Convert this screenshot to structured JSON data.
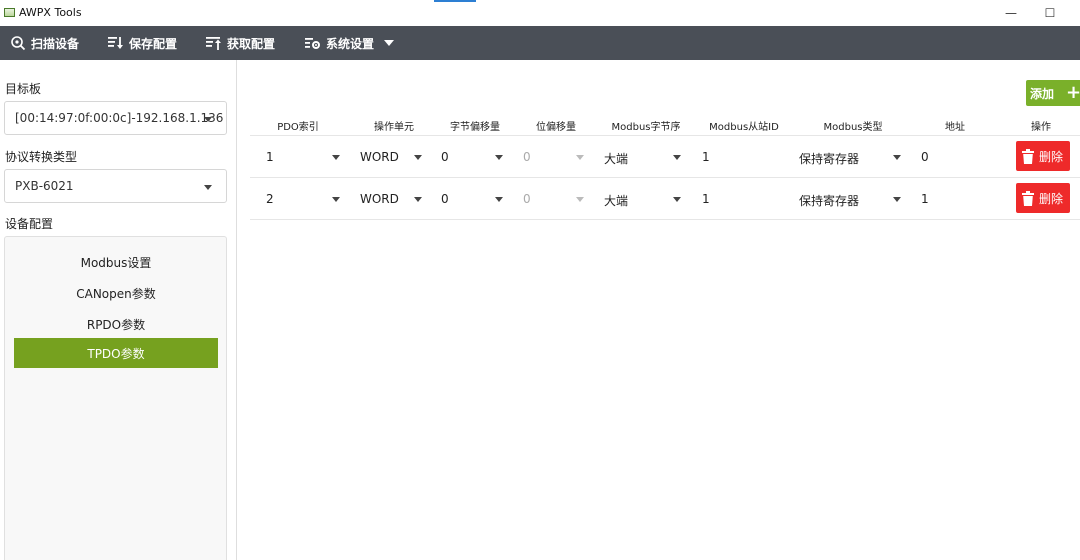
{
  "window": {
    "title": "AWPX Tools",
    "minimize": "—",
    "maximize": "☐"
  },
  "toolbar": {
    "scan_label": "扫描设备",
    "save_label": "保存配置",
    "fetch_label": "获取配置",
    "settings_label": "系统设置"
  },
  "sidebar": {
    "target_label": "目标板",
    "target_value": "[00:14:97:0f:00:0c]-192.168.1.136",
    "protocol_label": "协议转换类型",
    "protocol_value": "PXB-6021",
    "device_label": "设备配置",
    "menu": [
      {
        "label": "Modbus设置"
      },
      {
        "label": "CANopen参数"
      },
      {
        "label": "RPDO参数"
      },
      {
        "label": "TPDO参数"
      }
    ]
  },
  "main": {
    "add_label": "添加",
    "columns": [
      "PDO索引",
      "操作单元",
      "字节偏移量",
      "位偏移量",
      "Modbus字节序",
      "Modbus从站ID",
      "Modbus类型",
      "地址",
      "操作"
    ],
    "rows": [
      {
        "index": "1",
        "unit": "WORD",
        "byte_offset": "0",
        "bit_offset": "0",
        "byte_order": "大端",
        "slave_id": "1",
        "type": "保持寄存器",
        "address": "0",
        "delete_label": "删除"
      },
      {
        "index": "2",
        "unit": "WORD",
        "byte_offset": "0",
        "bit_offset": "0",
        "byte_order": "大端",
        "slave_id": "1",
        "type": "保持寄存器",
        "address": "1",
        "delete_label": "删除"
      }
    ]
  },
  "colors": {
    "toolbar_bg": "#4a4f57",
    "accent_green": "#76a11f",
    "add_green": "#7ab02a",
    "delete_red": "#ee2a2a"
  }
}
